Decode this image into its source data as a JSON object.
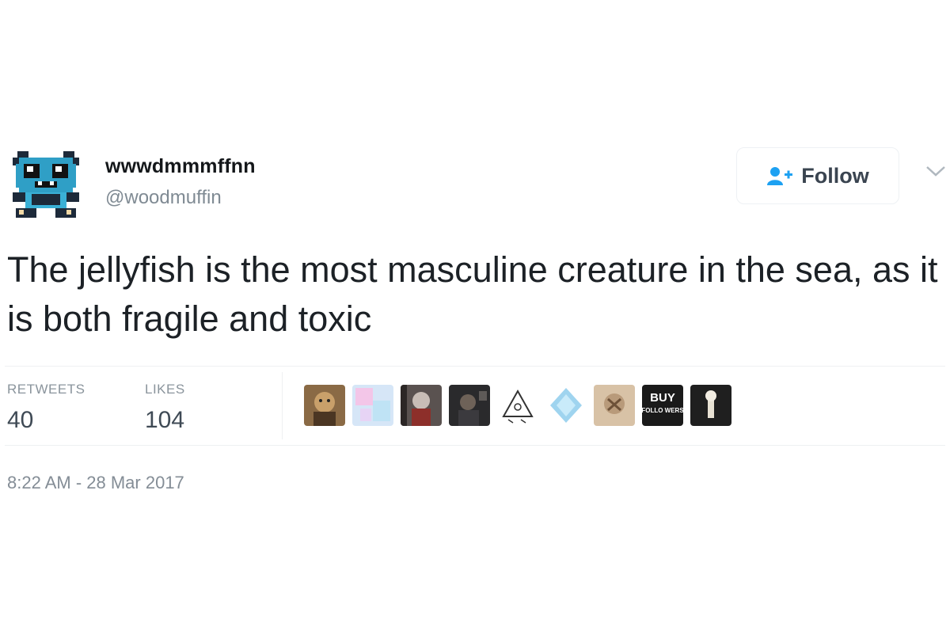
{
  "tweet": {
    "display_name": "wwwdmmmffnn",
    "handle": "@woodmuffin",
    "text": "The jellyfish is the most masculine creature in the sea, as it is both fragile and toxic",
    "follow_label": "Follow",
    "follow_icon": "add-user-icon",
    "menu_icon": "chevron-down-icon",
    "stats": {
      "retweets_label": "RETWEETS",
      "retweets_count": "40",
      "likes_label": "LIKES",
      "likes_count": "104"
    },
    "likers": [
      {
        "name": "liker-avatar-1"
      },
      {
        "name": "liker-avatar-2"
      },
      {
        "name": "liker-avatar-3"
      },
      {
        "name": "liker-avatar-4"
      },
      {
        "name": "liker-avatar-5"
      },
      {
        "name": "liker-avatar-6"
      },
      {
        "name": "liker-avatar-7"
      },
      {
        "name": "liker-avatar-8",
        "text_top": "BUY",
        "text_bottom": "FOLLO WERS"
      },
      {
        "name": "liker-avatar-9"
      }
    ],
    "timestamp": "8:22 AM - 28 Mar 2017"
  },
  "colors": {
    "text": "#14171a",
    "muted": "#848d96",
    "follow_icon": "#1da1f2"
  }
}
